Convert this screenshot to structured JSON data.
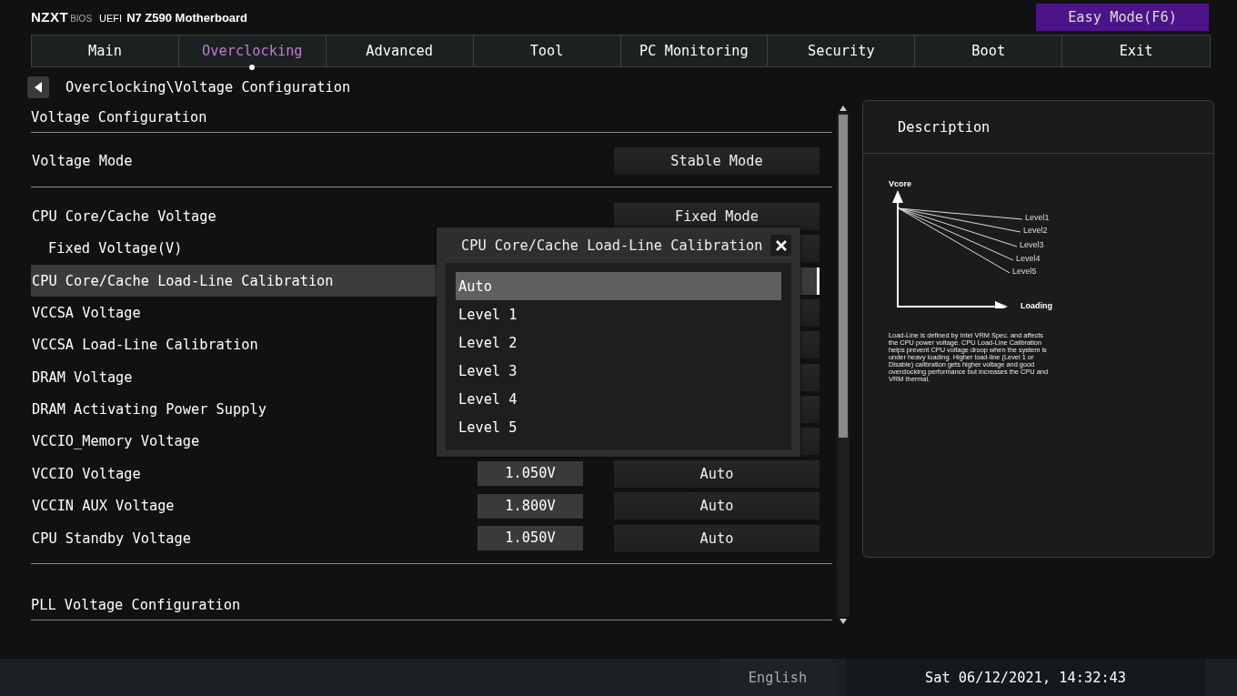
{
  "header": {
    "brand": "NZXT",
    "brand_sub": "BIOS",
    "firmware": "UEFI",
    "board": "N7 Z590 Motherboard",
    "easy_mode": "Easy Mode(F6)"
  },
  "tabs": [
    {
      "label": "Main",
      "selected": false
    },
    {
      "label": "Overclocking",
      "selected": true
    },
    {
      "label": "Advanced",
      "selected": false
    },
    {
      "label": "Tool",
      "selected": false
    },
    {
      "label": "PC Monitoring",
      "selected": false
    },
    {
      "label": "Security",
      "selected": false
    },
    {
      "label": "Boot",
      "selected": false
    },
    {
      "label": "Exit",
      "selected": false
    }
  ],
  "breadcrumb": "Overclocking\\Voltage Configuration",
  "sections": [
    {
      "title": "Voltage Configuration",
      "rows": [
        {
          "label": "Voltage Mode",
          "option": "Stable Mode",
          "selected": false
        }
      ]
    },
    {
      "rows": [
        {
          "label": "CPU Core/Cache Voltage",
          "option": "Fixed Mode",
          "selected": false,
          "children": [
            {
              "label": "Fixed Voltage(V)",
              "selected": false
            }
          ]
        },
        {
          "label": "CPU Core/Cache Load-Line Calibration",
          "selected": true
        },
        {
          "label": "VCCSA Voltage",
          "selected": false
        },
        {
          "label": "VCCSA Load-Line Calibration",
          "selected": false
        },
        {
          "label": "DRAM Voltage",
          "selected": false
        },
        {
          "label": "DRAM Activating Power Supply",
          "selected": false
        },
        {
          "label": "VCCIO_Memory Voltage",
          "selected": false
        },
        {
          "label": "VCCIO Voltage",
          "value": "1.050V",
          "option": "Auto",
          "selected": false
        },
        {
          "label": "VCCIN AUX Voltage",
          "value": "1.800V",
          "option": "Auto",
          "selected": false
        },
        {
          "label": "CPU Standby Voltage",
          "value": "1.050V",
          "option": "Auto",
          "selected": false
        }
      ]
    },
    {
      "title": "PLL Voltage Configuration"
    }
  ],
  "popup": {
    "title": "CPU Core/Cache Load-Line Calibration",
    "options": [
      {
        "label": "Auto",
        "selected": true
      },
      {
        "label": "Level 1",
        "selected": false
      },
      {
        "label": "Level 2",
        "selected": false
      },
      {
        "label": "Level 3",
        "selected": false
      },
      {
        "label": "Level 4",
        "selected": false
      },
      {
        "label": "Level 5",
        "selected": false
      }
    ]
  },
  "description": {
    "title": "Description",
    "diagram": {
      "y_axis": "Vcore",
      "x_axis": "Loading",
      "lines": [
        "Level1",
        "Level2",
        "Level3",
        "Level4",
        "Level5"
      ]
    },
    "text": "Load-Line is defined by Intel VRM Spec. and affects the CPU power voltage. CPU Load-Line Calibration helps prevent CPU voltage droop when the system is under heavy loading. Higher load-line (Level 1 or Disable) calibration gets higher voltage and good overclocking performance but increases the CPU and VRM thermal."
  },
  "status_bar": {
    "language": "English",
    "datetime": "Sat 06/12/2021, 14:32:43"
  }
}
